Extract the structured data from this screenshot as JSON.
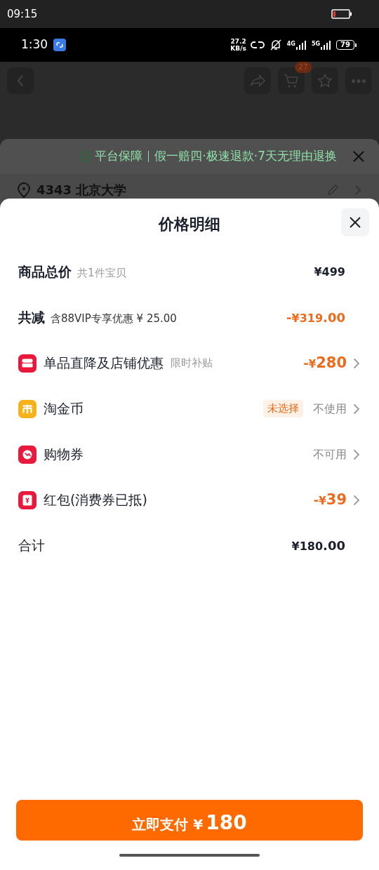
{
  "outer_status_bar": {
    "time": "09:15"
  },
  "status_bar": {
    "time": "1:30",
    "speed": "27.2",
    "speed_unit": "KB/s",
    "net_1": "4G",
    "net_2": "5G",
    "battery": "79"
  },
  "background_page": {
    "cart_badge": "27",
    "guarantee": {
      "title": "平台保障",
      "text": "假一赔四·极速退款·7天无理由退换"
    },
    "address": "4343 北京大学"
  },
  "sheet": {
    "title": "价格明细",
    "summary_rows": [
      {
        "label": "商品总价",
        "note": "共1件宝贝",
        "price": {
          "currency": "¥",
          "integer": "499"
        }
      },
      {
        "label": "共减",
        "note": "含88VIP专享优惠 ¥ 25.00",
        "price": {
          "sign": "-",
          "currency": "¥",
          "integer": "319",
          "decimal": ".00"
        }
      }
    ],
    "discount_rows": [
      {
        "label": "单品直降及店铺优惠",
        "note": "限时补贴",
        "color": "#e8193c",
        "kind": "price",
        "price": {
          "sign": "-",
          "currency": "¥",
          "integer": "280"
        }
      },
      {
        "label": "淘金币",
        "badge": "未选择",
        "color": "#f7b21a",
        "kind": "status",
        "value": "不使用"
      },
      {
        "label": "购物券",
        "color": "#e8193c",
        "kind": "status",
        "value": "不可用"
      },
      {
        "label": "红包(消费券已抵)",
        "color": "#e8193c",
        "kind": "price",
        "price": {
          "sign": "-",
          "currency": "¥",
          "integer": "39"
        }
      }
    ],
    "total": {
      "label": "合计",
      "currency": "¥",
      "integer": "180",
      "decimal": ".00"
    },
    "pay_button": {
      "label": "立即支付",
      "currency": "¥",
      "amount": "180"
    }
  }
}
